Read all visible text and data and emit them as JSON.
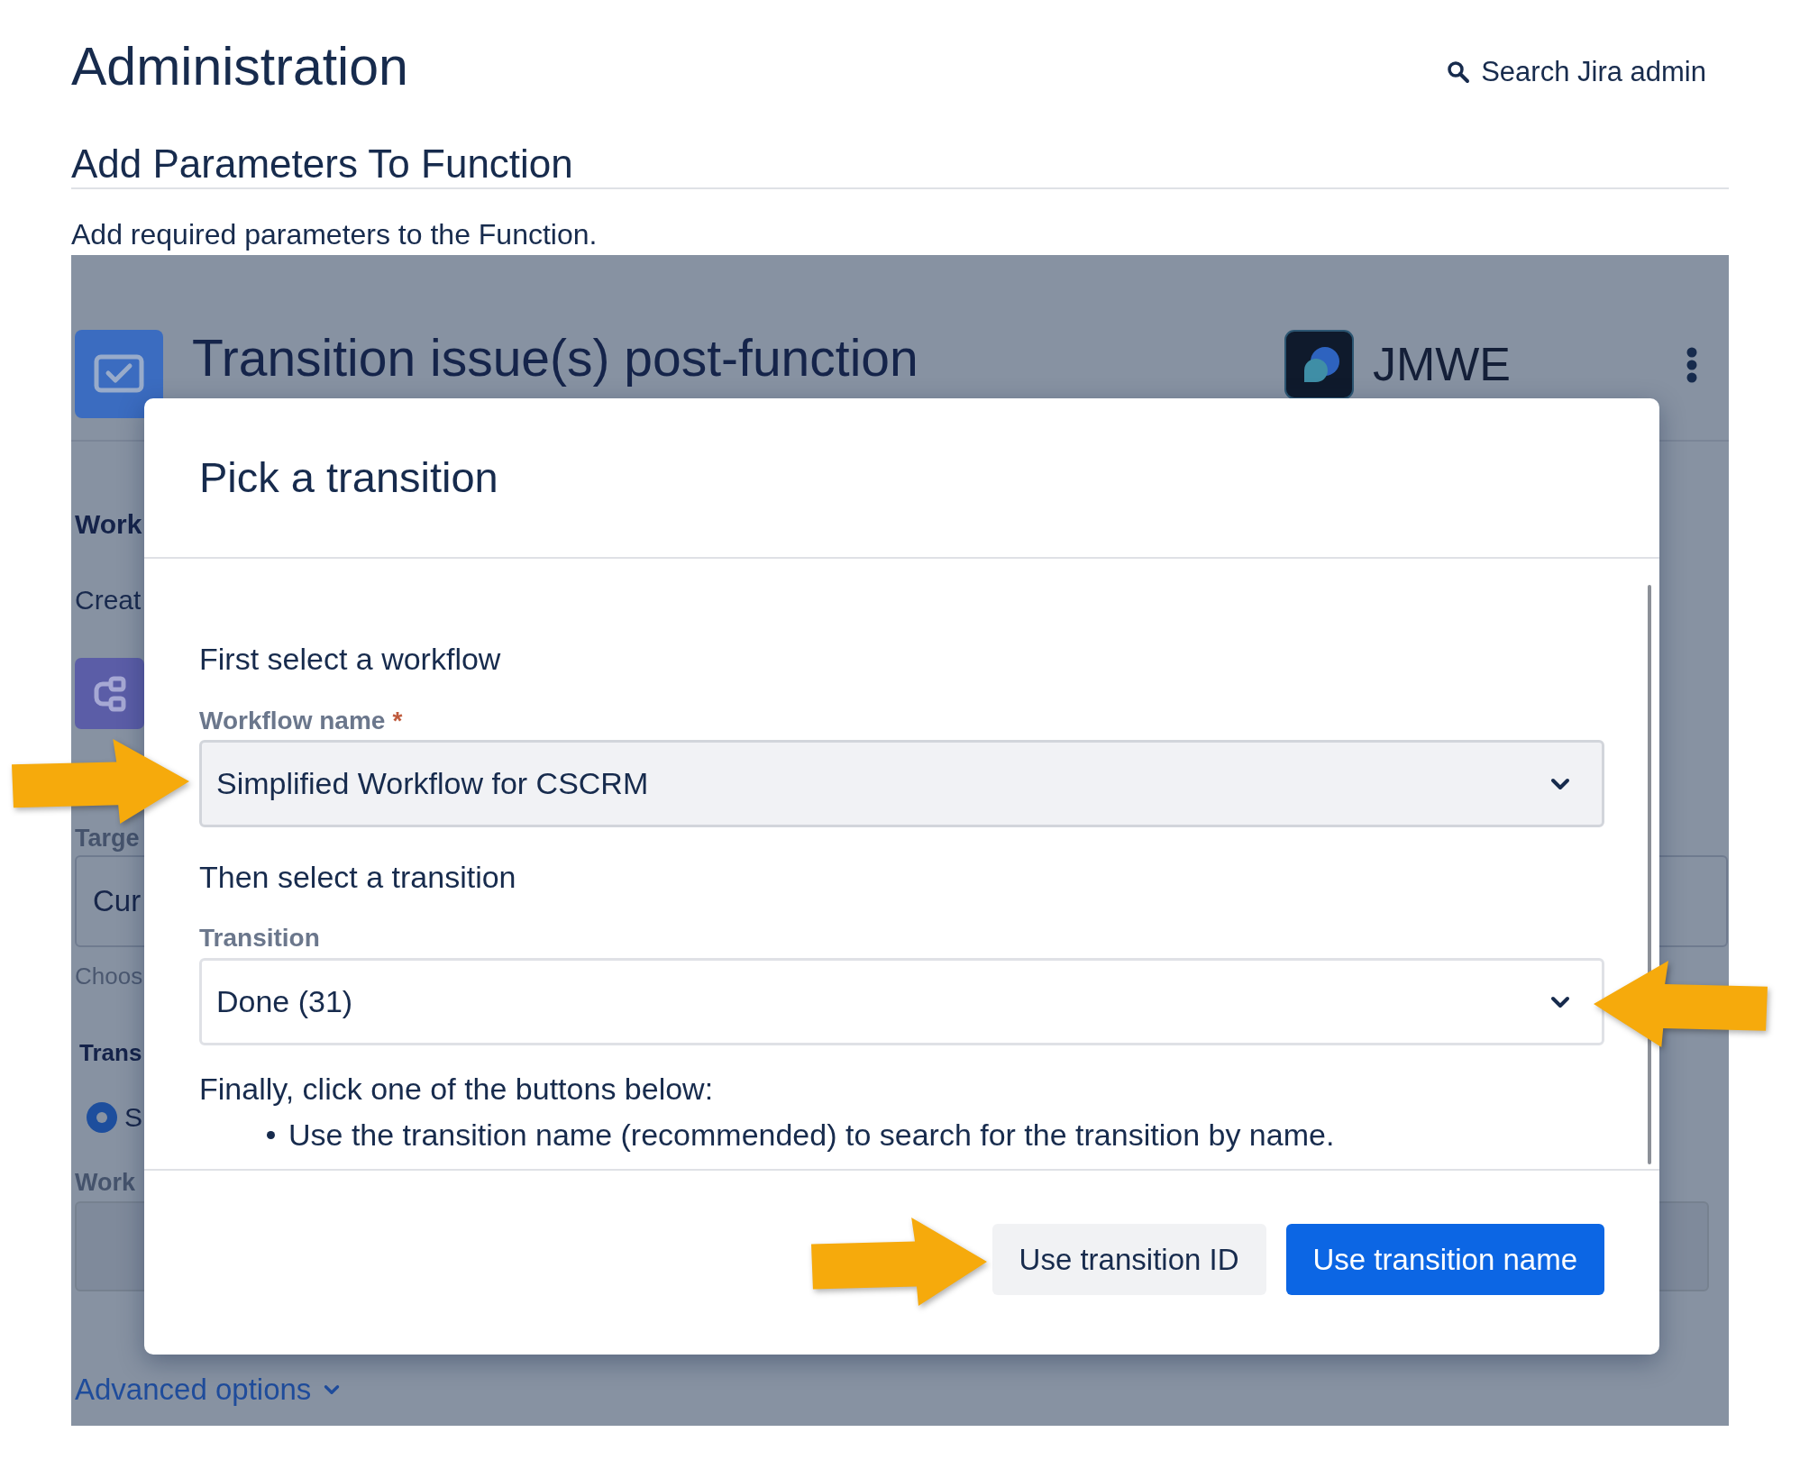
{
  "header": {
    "title": "Administration",
    "search_link": "Search Jira admin"
  },
  "page": {
    "heading": "Add Parameters To Function",
    "description": "Add required parameters to the Function."
  },
  "function_card": {
    "title": "Transition issue(s) post-function",
    "vendor": "JMWE",
    "section_heading": "Work",
    "section_text": "Creat",
    "target_label": "Targe",
    "target_value": "Cur",
    "target_hint": "Choos",
    "transition_heading": "Trans",
    "transition_options": [
      {
        "label": "S",
        "selected": true
      }
    ],
    "workflow_label": "Work",
    "advanced_link": "Advanced options"
  },
  "dialog": {
    "title": "Pick a transition",
    "fields": [
      {
        "instruction": "First select a workflow",
        "label": "Workflow name",
        "required_mark": "*",
        "value": "Simplified Workflow for CSCRM",
        "hovered": true
      },
      {
        "instruction": "Then select a transition",
        "label": "Transition",
        "value": "Done (31)",
        "hovered": false
      }
    ],
    "final_instruction": "Finally, click one of the buttons below:",
    "bullets": [
      "Use the transition name (recommended) to search for the transition by name."
    ],
    "buttons": [
      {
        "label": "Use transition ID",
        "kind": "secondary"
      },
      {
        "label": "Use transition name",
        "kind": "primary"
      }
    ]
  }
}
